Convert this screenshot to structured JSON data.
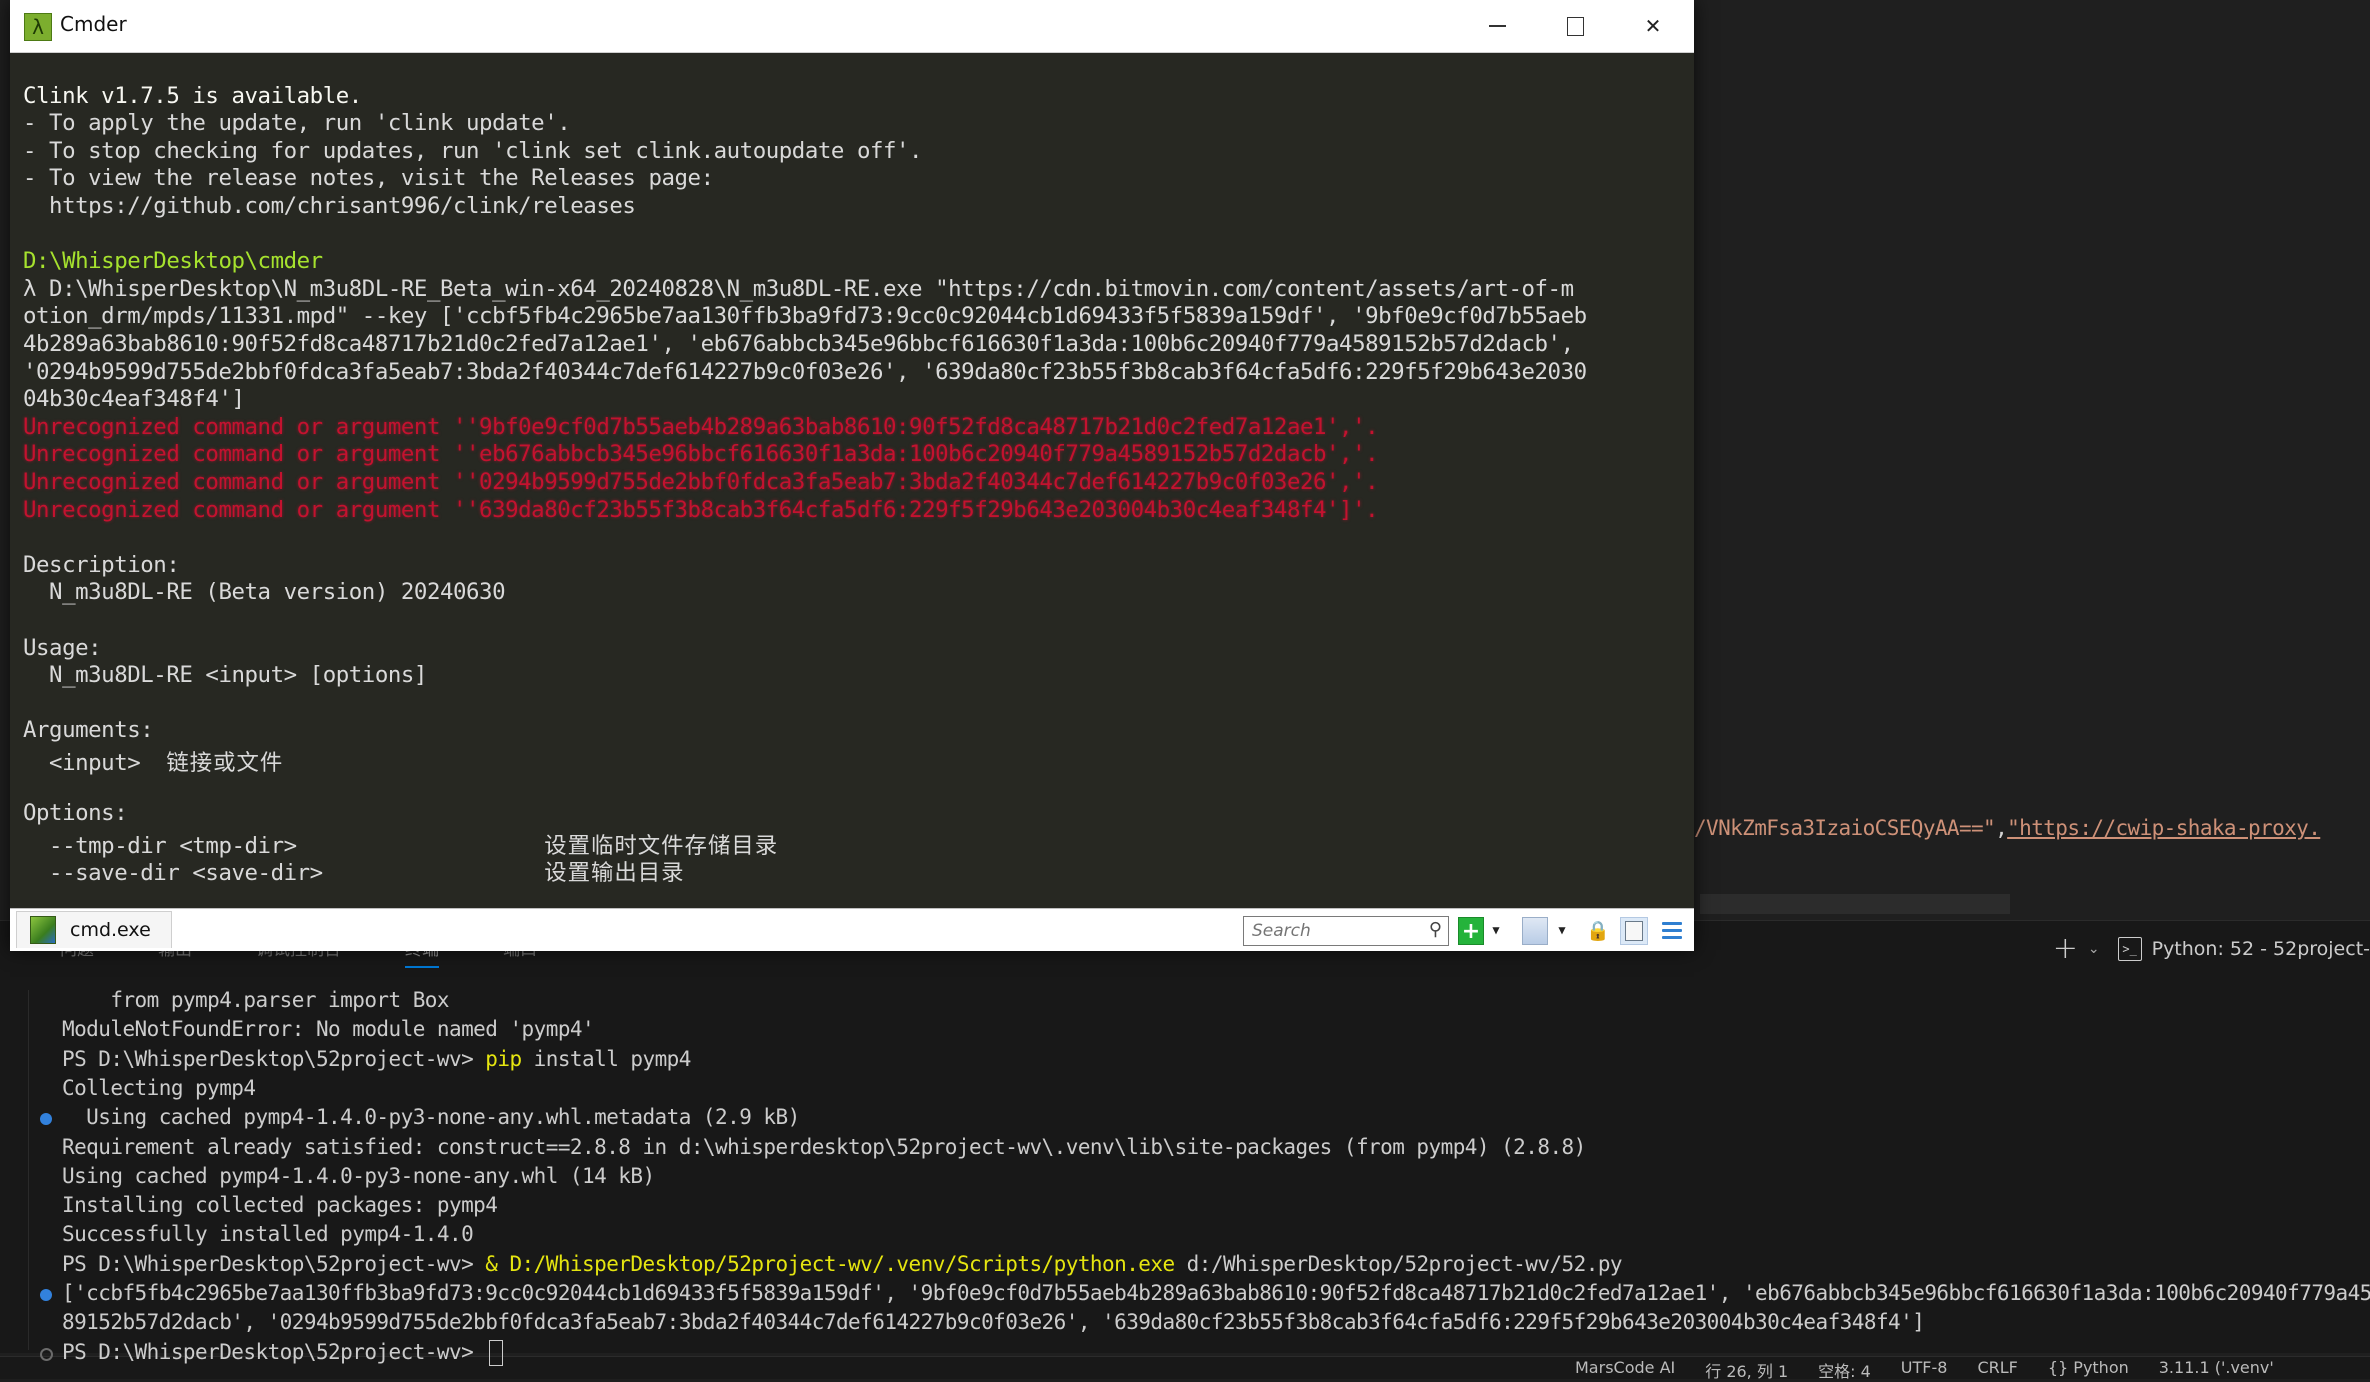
{
  "vscode": {
    "editor_fragment": {
      "string_tail": "/VNkZmFsa3IzaioCSEQyAA==\"",
      "separator": ",",
      "link_text": "\"https://cwip-shaka-proxy."
    },
    "panel_tabs": [
      {
        "label": "问题",
        "active": false
      },
      {
        "label": "输出",
        "active": false
      },
      {
        "label": "调试控制台",
        "active": false
      },
      {
        "label": "终端",
        "active": true
      },
      {
        "label": "端口",
        "active": false
      }
    ],
    "panel_actions": {
      "new_terminal_icon": "plus-icon",
      "dropdown_icon": "chevron-down-icon",
      "terminal_icon": "terminal-icon",
      "terminal_name": "Python: 52 - 52project-"
    },
    "terminal_lines": [
      {
        "text": "    from pymp4.parser import Box"
      },
      {
        "text": "ModuleNotFoundError: No module named 'pymp4'"
      },
      {
        "prompt": "PS D:\\WhisperDesktop\\52project-wv> ",
        "cmd": "pip",
        "rest": " install pymp4"
      },
      {
        "text": "Collecting pymp4"
      },
      {
        "text": "  Using cached pymp4-1.4.0-py3-none-any.whl.metadata (2.9 kB)",
        "decoration": "blue"
      },
      {
        "text": "Requirement already satisfied: construct==2.8.8 in d:\\whisperdesktop\\52project-wv\\.venv\\lib\\site-packages (from pymp4) (2.8.8)"
      },
      {
        "text": "Using cached pymp4-1.4.0-py3-none-any.whl (14 kB)"
      },
      {
        "text": "Installing collected packages: pymp4"
      },
      {
        "text": "Successfully installed pymp4-1.4.0"
      },
      {
        "prompt": "PS D:\\WhisperDesktop\\52project-wv> ",
        "cmd": "& ",
        "path": "D:/WhisperDesktop/52project-wv/.venv/Scripts/python.exe",
        "rest": " d:/WhisperDesktop/52project-wv/52.py"
      },
      {
        "text": "['ccbf5fb4c2965be7aa130ffb3ba9fd73:9cc0c92044cb1d69433f5f5839a159df', '9bf0e9cf0d7b55aeb4b289a63bab8610:90f52fd8ca48717b21d0c2fed7a12ae1', 'eb676abbcb345e96bbcf616630f1a3da:100b6c20940f779a45",
        "decoration": "blue"
      },
      {
        "text": "89152b57d2dacb', '0294b9599d755de2bbf0fdca3fa5eab7:3bda2f40344c7def614227b9c0f03e26', '639da80cf23b55f3b8cab3f64cfa5df6:229f5f29b643e203004b30c4eaf348f4']"
      },
      {
        "prompt": "PS D:\\WhisperDesktop\\52project-wv> ",
        "decoration": "hollow",
        "cursor": true
      }
    ],
    "status_bar": [
      "MarsCode AI",
      "行 26, 列 1",
      "空格: 4",
      "UTF-8",
      "CRLF",
      "{} Python",
      "3.11.1 ('.venv'"
    ]
  },
  "cmder": {
    "title": "Cmder",
    "logo_glyph": "λ",
    "window_buttons": {
      "minimize": "minimize",
      "maximize": "maximize",
      "close": "✕"
    },
    "lines": [
      {
        "text": "",
        "style": ""
      },
      {
        "text": "Clink v1.7.5 is available.",
        "style": ""
      },
      {
        "text": "- To apply the update, run 'clink update'.",
        "style": "dim"
      },
      {
        "text": "- To stop checking for updates, run 'clink set clink.autoupdate off'.",
        "style": "dim"
      },
      {
        "text": "- To view the release notes, visit the Releases page:",
        "style": "dim"
      },
      {
        "text": "  https://github.com/chrisant996/clink/releases",
        "style": "dim"
      },
      {
        "text": "",
        "style": ""
      },
      {
        "text": "D:\\WhisperDesktop\\cmder",
        "style": "green"
      },
      {
        "text": "λ D:\\WhisperDesktop\\N_m3u8DL-RE_Beta_win-x64_20240828\\N_m3u8DL-RE.exe \"https://cdn.bitmovin.com/content/assets/art-of-m",
        "style": "dim"
      },
      {
        "text": "otion_drm/mpds/11331.mpd\" --key ['ccbf5fb4c2965be7aa130ffb3ba9fd73:9cc0c92044cb1d69433f5f5839a159df', '9bf0e9cf0d7b55aeb",
        "style": "dim"
      },
      {
        "text": "4b289a63bab8610:90f52fd8ca48717b21d0c2fed7a12ae1', 'eb676abbcb345e96bbcf616630f1a3da:100b6c20940f779a4589152b57d2dacb',",
        "style": "dim"
      },
      {
        "text": "'0294b9599d755de2bbf0fdca3fa5eab7:3bda2f40344c7def614227b9c0f03e26', '639da80cf23b55f3b8cab3f64cfa5df6:229f5f29b643e2030",
        "style": "dim"
      },
      {
        "text": "04b30c4eaf348f4']",
        "style": "dim"
      },
      {
        "text": "Unrecognized command or argument ''9bf0e9cf0d7b55aeb4b289a63bab8610:90f52fd8ca48717b21d0c2fed7a12ae1','.",
        "style": "err"
      },
      {
        "text": "Unrecognized command or argument ''eb676abbcb345e96bbcf616630f1a3da:100b6c20940f779a4589152b57d2dacb','.",
        "style": "err"
      },
      {
        "text": "Unrecognized command or argument ''0294b9599d755de2bbf0fdca3fa5eab7:3bda2f40344c7def614227b9c0f03e26','.",
        "style": "err"
      },
      {
        "text": "Unrecognized command or argument ''639da80cf23b55f3b8cab3f64cfa5df6:229f5f29b643e203004b30c4eaf348f4']'.",
        "style": "err"
      },
      {
        "text": "",
        "style": ""
      },
      {
        "text": "Description:",
        "style": "dim"
      },
      {
        "text": "  N_m3u8DL-RE (Beta version) 20240630",
        "style": "dim"
      },
      {
        "text": "",
        "style": ""
      },
      {
        "text": "Usage:",
        "style": "dim"
      },
      {
        "text": "  N_m3u8DL-RE <input> [options]",
        "style": "dim"
      },
      {
        "text": "",
        "style": ""
      },
      {
        "text": "Arguments:",
        "style": "dim"
      },
      {
        "text": "  <input>  ",
        "cn": "链接或文件",
        "style": "dim"
      },
      {
        "text": "",
        "style": ""
      },
      {
        "text": "Options:",
        "style": "dim"
      },
      {
        "text": "  --tmp-dir <tmp-dir>                   ",
        "cn": "设置临时文件存储目录",
        "style": "dim"
      },
      {
        "text": "  --save-dir <save-dir>                 ",
        "cn": "设置输出目录",
        "style": "dim"
      }
    ],
    "tab": {
      "label": "cmd.exe"
    },
    "toolbar": {
      "search_placeholder": "Search",
      "search_icon": "⚲",
      "new_console_glyph": "+",
      "dropdown_glyph": "▼",
      "lock_glyph": "🔒"
    },
    "colors": {
      "background": "#272822",
      "prompt_path": "#a6e22e",
      "error": "#c3122f"
    }
  }
}
